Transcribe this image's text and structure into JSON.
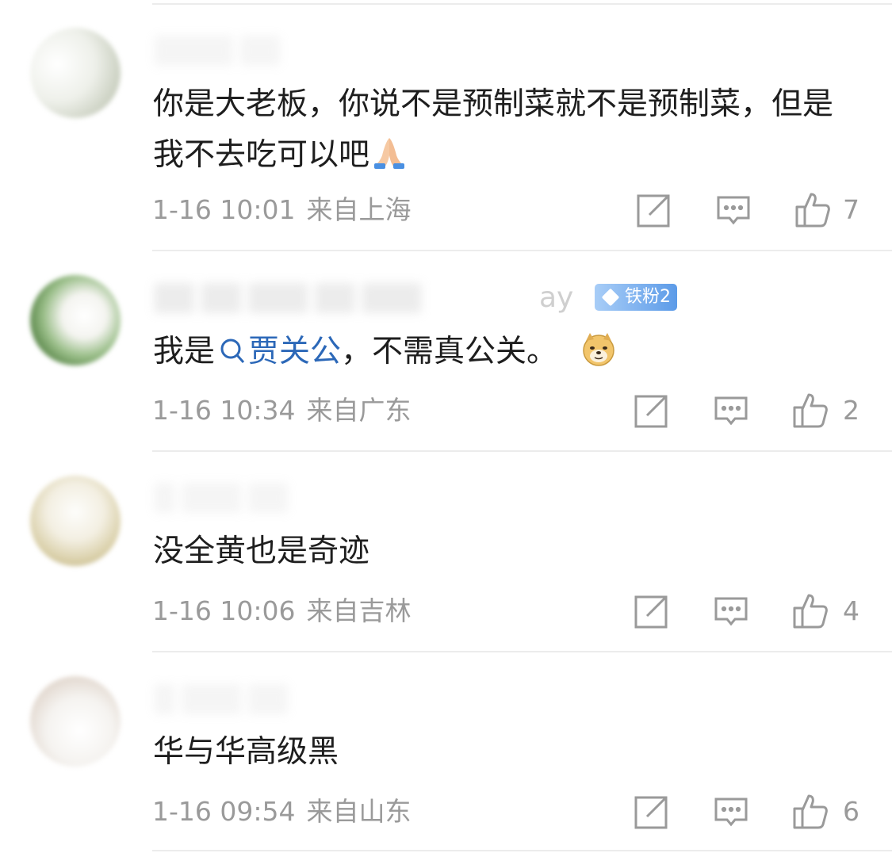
{
  "comments": [
    {
      "text": "你是大老板，你说不是预制菜就不是预制菜，但是我不去吃可以吧",
      "emoji": "folded-hands-emoji",
      "date": "1-16 10:01",
      "location": "来自上海",
      "likes": "7"
    },
    {
      "username_suffix": "ay",
      "badge": "铁粉2",
      "text_before": "我是",
      "topic": "贾关公",
      "text_after": "，不需真公关。",
      "emoji": "doge-emoji",
      "date": "1-16 10:34",
      "location": "来自广东",
      "likes": "2"
    },
    {
      "text": "没全黄也是奇迹",
      "date": "1-16 10:06",
      "location": "来自吉林",
      "likes": "4"
    },
    {
      "text": "华与华高级黑",
      "date": "1-16 09:54",
      "location": "来自山东",
      "likes": "6"
    }
  ],
  "colors": {
    "text": "#1e1e1e",
    "meta": "#9a9a9a",
    "link": "#2c68b8",
    "badge": "#5c9be8",
    "divider": "#ececec"
  }
}
